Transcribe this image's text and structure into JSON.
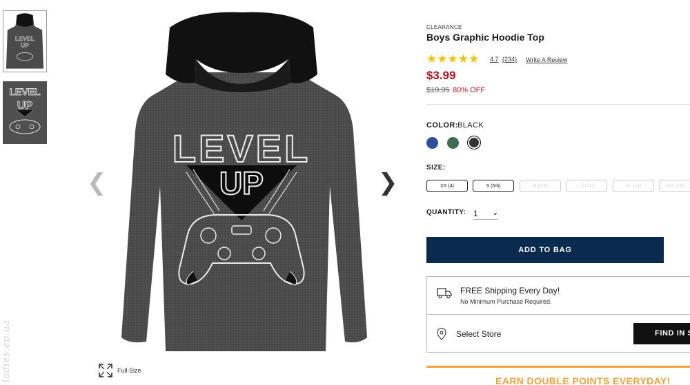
{
  "product": {
    "badge": "CLEARANCE",
    "title": "Boys Graphic Hoodie Top",
    "rating": "4.7",
    "review_count": "(234)",
    "write_review": "Write A Review",
    "price": "$3.99",
    "original_price": "$19.95",
    "discount": "80% OFF",
    "stars": "★★★★★"
  },
  "gallery": {
    "prev_arrow": "❮",
    "next_arrow": "❯",
    "full_size": "Full Size",
    "graphic_line1": "LEVEL",
    "graphic_line2": "UP"
  },
  "color": {
    "label": "COLOR:",
    "value": "BLACK",
    "swatches": [
      "blue",
      "green",
      "black"
    ],
    "selected": "black"
  },
  "size": {
    "label": "SIZE:",
    "options": [
      "XS (4)",
      "S (5/6)",
      "M (7/8)",
      "L (10/12)",
      "XL (14)",
      "XXL (16)"
    ],
    "available": [
      "XS (4)",
      "S (5/6)"
    ]
  },
  "quantity": {
    "label": "QUANTITY:",
    "value": "1"
  },
  "actions": {
    "add_to_bag": "ADD TO BAG",
    "find_in_store": "FIND IN STORE"
  },
  "shipping": {
    "title": "FREE Shipping Every Day!",
    "subtitle": "No Minimum Purchase Required."
  },
  "store": {
    "label": "Select Store"
  },
  "promo": {
    "text": "EARN DOUBLE POINTS EVERYDAY!"
  },
  "watermark": "ladies.ep.ua",
  "colors": {
    "price_red": "#b7151f",
    "add_bag_navy": "#0b2a4f",
    "star_gold": "#f2c200",
    "promo_orange": "#f0a13c"
  }
}
